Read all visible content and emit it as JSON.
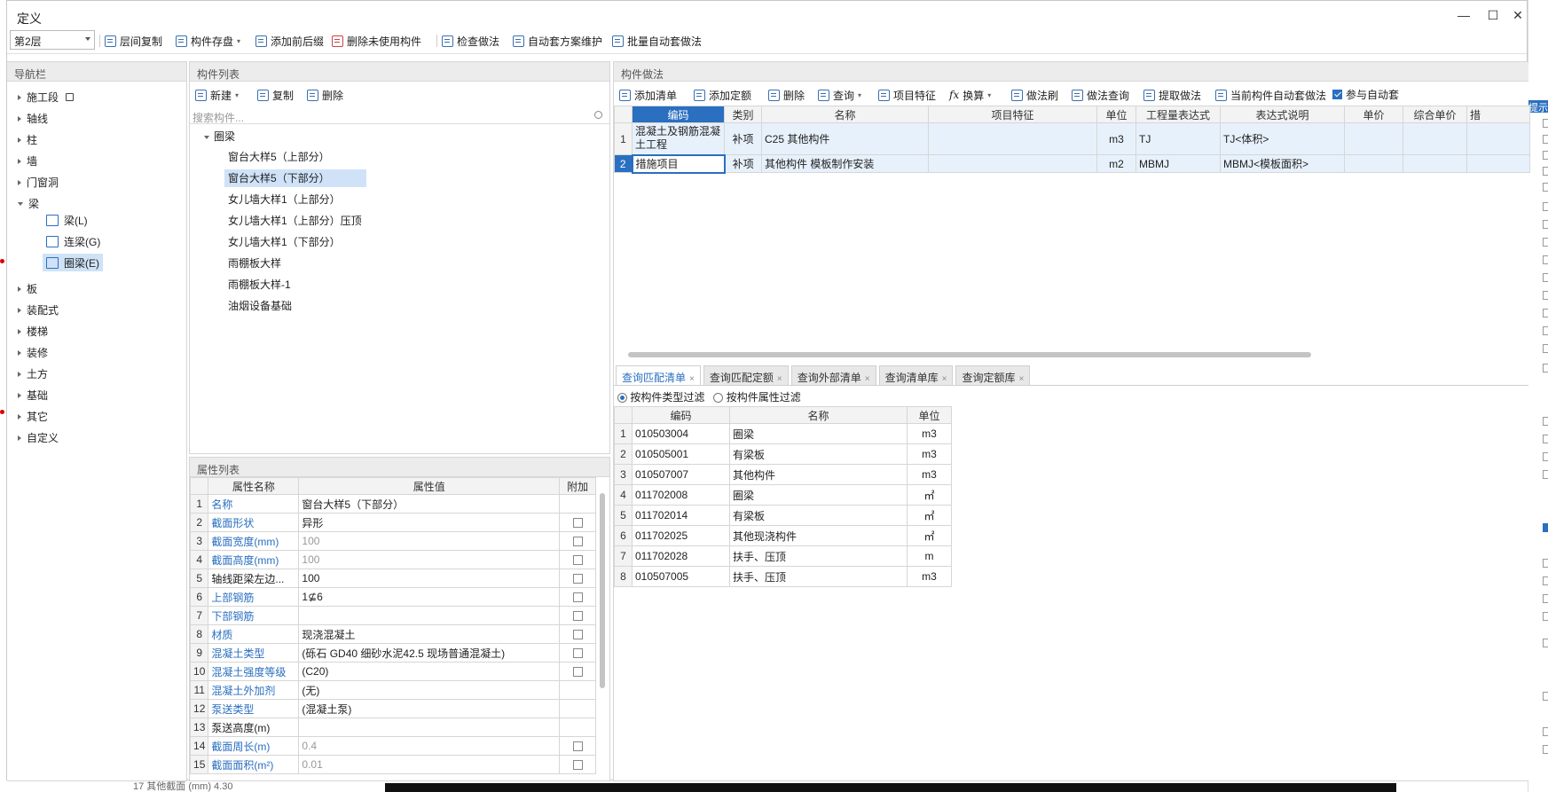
{
  "window": {
    "title": "定义",
    "controls": [
      "—",
      "☐",
      "✕"
    ]
  },
  "toolbar": {
    "floor_value": "第2层",
    "buttons": [
      "层间复制",
      "构件存盘",
      "添加前后缀",
      "删除未使用构件",
      "检查做法",
      "自动套方案维护",
      "批量自动套做法"
    ]
  },
  "nav": {
    "header": "导航栏",
    "items": [
      "施工段",
      "轴线",
      "柱",
      "墙",
      "门窗洞",
      "梁",
      "板",
      "装配式",
      "楼梯",
      "装修",
      "土方",
      "基础",
      "其它",
      "自定义"
    ],
    "beam_children": [
      "梁(L)",
      "连梁(G)",
      "圈梁(E)"
    ]
  },
  "component_list": {
    "header": "构件列表",
    "toolbar": [
      "新建",
      "复制",
      "删除"
    ],
    "search_placeholder": "搜索构件...",
    "group": "圈梁",
    "items": [
      "窗台大样5（上部分）",
      "窗台大样5（下部分）",
      "女儿墙大样1（上部分）",
      "女儿墙大样1（上部分）压顶",
      "女儿墙大样1（下部分）",
      "雨棚板大样",
      "雨棚板大样-1",
      "油烟设备基础"
    ]
  },
  "property_list": {
    "header": "属性列表",
    "columns": [
      "属性名称",
      "属性值",
      "附加"
    ],
    "rows": [
      {
        "n": "1",
        "name": "名称",
        "value": "窗台大样5（下部分）",
        "blue": true,
        "gray": false,
        "cb": false
      },
      {
        "n": "2",
        "name": "截面形状",
        "value": "异形",
        "blue": true,
        "gray": false,
        "cb": true
      },
      {
        "n": "3",
        "name": "截面宽度(mm)",
        "value": "100",
        "blue": true,
        "gray": true,
        "cb": true
      },
      {
        "n": "4",
        "name": "截面高度(mm)",
        "value": "100",
        "blue": true,
        "gray": true,
        "cb": true
      },
      {
        "n": "5",
        "name": "轴线距梁左边...",
        "value": "100",
        "blue": false,
        "gray": false,
        "cb": true
      },
      {
        "n": "6",
        "name": "上部钢筋",
        "value": "1⊈6",
        "blue": true,
        "gray": false,
        "cb": true
      },
      {
        "n": "7",
        "name": "下部钢筋",
        "value": "",
        "blue": true,
        "gray": false,
        "cb": true
      },
      {
        "n": "8",
        "name": "材质",
        "value": "现浇混凝土",
        "blue": true,
        "gray": false,
        "cb": true
      },
      {
        "n": "9",
        "name": "混凝土类型",
        "value": "(砾石 GD40 细砂水泥42.5  现场普通混凝土)",
        "blue": true,
        "gray": false,
        "cb": true
      },
      {
        "n": "10",
        "name": "混凝土强度等级",
        "value": "(C20)",
        "blue": true,
        "gray": false,
        "cb": true
      },
      {
        "n": "11",
        "name": "混凝土外加剂",
        "value": "(无)",
        "blue": true,
        "gray": false,
        "cb": false
      },
      {
        "n": "12",
        "name": "泵送类型",
        "value": "(混凝土泵)",
        "blue": true,
        "gray": false,
        "cb": false
      },
      {
        "n": "13",
        "name": "泵送高度(m)",
        "value": "",
        "blue": false,
        "gray": false,
        "cb": false
      },
      {
        "n": "14",
        "name": "截面周长(m)",
        "value": "0.4",
        "blue": true,
        "gray": true,
        "cb": true
      },
      {
        "n": "15",
        "name": "截面面积(m²)",
        "value": "0.01",
        "blue": true,
        "gray": true,
        "cb": true
      }
    ]
  },
  "method": {
    "header": "构件做法",
    "toolbar": [
      "添加清单",
      "添加定额",
      "删除",
      "查询",
      "项目特征",
      "换算",
      "做法刷",
      "做法查询",
      "提取做法",
      "当前构件自动套做法",
      "参与自动套"
    ],
    "columns": [
      "编码",
      "类别",
      "名称",
      "项目特征",
      "单位",
      "工程量表达式",
      "表达式说明",
      "单价",
      "综合单价",
      "措"
    ],
    "rows": [
      {
        "n": "1",
        "code": "混凝土及钢筋混凝土工程",
        "type": "补项",
        "name": "C25  其他构件",
        "feature": "",
        "unit": "m3",
        "expr": "TJ",
        "desc": "TJ<体积>"
      },
      {
        "n": "2",
        "code": "措施项目",
        "type": "补项",
        "name": "其他构件 模板制作安装",
        "feature": "",
        "unit": "m2",
        "expr": "MBMJ",
        "desc": "MBMJ<模板面积>"
      }
    ]
  },
  "query": {
    "tabs": [
      "查询匹配清单",
      "查询匹配定额",
      "查询外部清单",
      "查询清单库",
      "查询定额库"
    ],
    "filter_type": "按构件类型过滤",
    "filter_attr": "按构件属性过滤",
    "columns": [
      "编码",
      "名称",
      "单位"
    ],
    "rows": [
      {
        "n": "1",
        "code": "010503004",
        "name": "圈梁",
        "unit": "m3"
      },
      {
        "n": "2",
        "code": "010505001",
        "name": "有梁板",
        "unit": "m3"
      },
      {
        "n": "3",
        "code": "010507007",
        "name": "其他构件",
        "unit": "m3"
      },
      {
        "n": "4",
        "code": "011702008",
        "name": "圈梁",
        "unit": "㎡"
      },
      {
        "n": "5",
        "code": "011702014",
        "name": "有梁板",
        "unit": "㎡"
      },
      {
        "n": "6",
        "code": "011702025",
        "name": "其他现浇构件",
        "unit": "㎡"
      },
      {
        "n": "7",
        "code": "011702028",
        "name": "扶手、压顶",
        "unit": "m"
      },
      {
        "n": "8",
        "code": "010507005",
        "name": "扶手、压顶",
        "unit": "m3"
      }
    ]
  },
  "background": {
    "bottom_text": "17  其他截面 (mm)   4.30",
    "right_label": "提示"
  },
  "colors": {
    "accent": "#2a6fc0",
    "selection": "#cfe2f7",
    "header_bg": "#ececec"
  }
}
